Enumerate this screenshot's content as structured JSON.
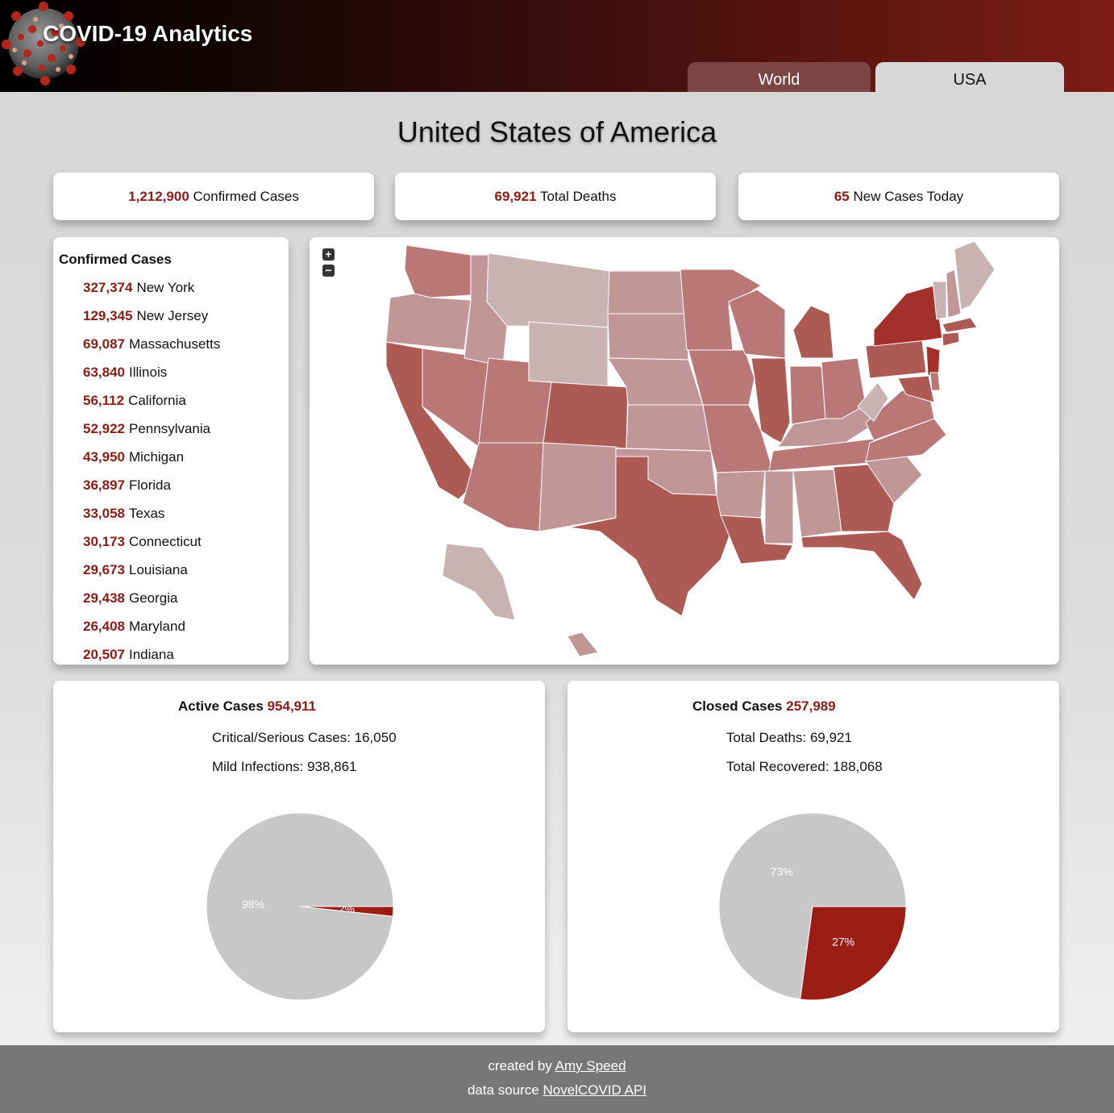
{
  "header": {
    "title": "COVID-19 Analytics",
    "tabs": [
      {
        "label": "World",
        "active": false
      },
      {
        "label": "USA",
        "active": true
      }
    ]
  },
  "page": {
    "title": "United States of America"
  },
  "stats": [
    {
      "value": "1,212,900",
      "label": "Confirmed Cases"
    },
    {
      "value": "69,921",
      "label": "Total Deaths"
    },
    {
      "value": "65",
      "label": "New Cases Today"
    }
  ],
  "confirmed_list": {
    "title": "Confirmed Cases",
    "items": [
      {
        "value": "327,374",
        "state": "New York"
      },
      {
        "value": "129,345",
        "state": "New Jersey"
      },
      {
        "value": "69,087",
        "state": "Massachusetts"
      },
      {
        "value": "63,840",
        "state": "Illinois"
      },
      {
        "value": "56,112",
        "state": "California"
      },
      {
        "value": "52,922",
        "state": "Pennsylvania"
      },
      {
        "value": "43,950",
        "state": "Michigan"
      },
      {
        "value": "36,897",
        "state": "Florida"
      },
      {
        "value": "33,058",
        "state": "Texas"
      },
      {
        "value": "30,173",
        "state": "Connecticut"
      },
      {
        "value": "29,673",
        "state": "Louisiana"
      },
      {
        "value": "29,438",
        "state": "Georgia"
      },
      {
        "value": "26,408",
        "state": "Maryland"
      },
      {
        "value": "20,507",
        "state": "Indiana"
      }
    ]
  },
  "map": {
    "zoom_in": "+",
    "zoom_out": "−",
    "colors": {
      "highest": "#a3302a",
      "high": "#ad5a55",
      "mid": "#b97876",
      "low": "#c09696",
      "lowest": "#c8b2b2"
    }
  },
  "active": {
    "heading": "Active Cases",
    "value": "954,911",
    "lines": [
      "Critical/Serious Cases: 16,050",
      "Mild Infections: 938,861"
    ]
  },
  "closed": {
    "heading": "Closed Cases",
    "value": "257,989",
    "lines": [
      "Total Deaths: 69,921",
      "Total Recovered: 188,068"
    ]
  },
  "chart_data": [
    {
      "type": "pie",
      "categories": [
        "Critical/Serious Cases",
        "Mild Infections"
      ],
      "values": [
        16050,
        938861
      ],
      "labels": [
        "2%",
        "98%"
      ],
      "colors": [
        "#9a1c12",
        "#c7c7c7"
      ]
    },
    {
      "type": "pie",
      "categories": [
        "Total Deaths",
        "Total Recovered"
      ],
      "values": [
        69921,
        188068
      ],
      "labels": [
        "27%",
        "73%"
      ],
      "colors": [
        "#9a1c12",
        "#c7c7c7"
      ]
    }
  ],
  "footer": {
    "created_prefix": "created by",
    "author": "Amy Speed",
    "source_prefix": "data source",
    "source": "NovelCOVID API"
  }
}
